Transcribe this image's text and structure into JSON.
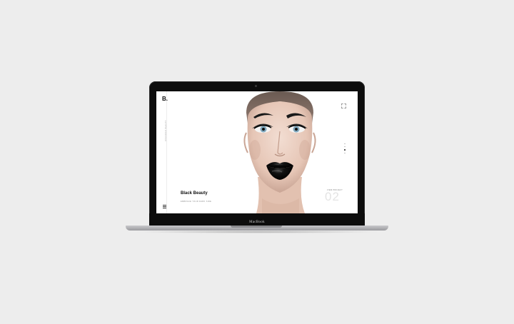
{
  "device": {
    "brand_label": "MacBook"
  },
  "site": {
    "logo": "B.",
    "vertical_caption": "DISCOVER BEAUTY",
    "slide": {
      "title": "Black Beauty",
      "subtitle": "EMBRACE YOUR DARK SIDE",
      "number": "02",
      "view_link": "VIEW PROJECT"
    },
    "pagination": {
      "count": 4,
      "active_index": 2
    }
  },
  "icons": {
    "menu": "hamburger-menu-icon",
    "expand": "expand-icon"
  },
  "colors": {
    "lipstick": "#050505",
    "background": "#ededed",
    "screen_bg": "#ffffff"
  }
}
